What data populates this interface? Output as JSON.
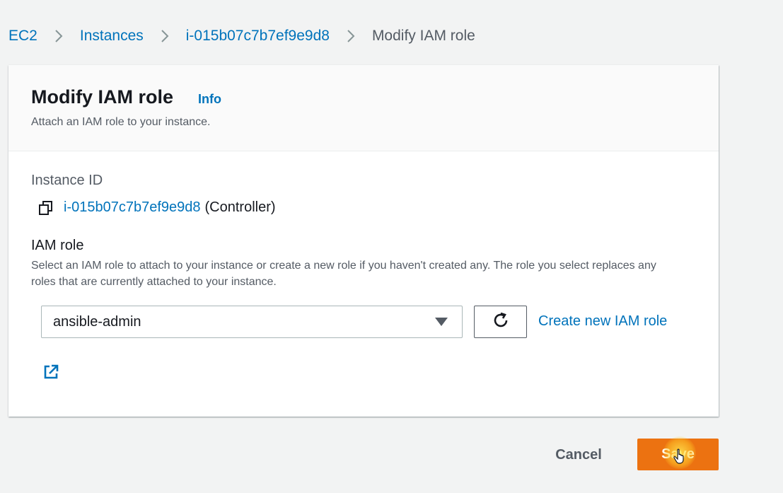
{
  "breadcrumb": {
    "items": [
      "EC2",
      "Instances",
      "i-015b07c7b7ef9e9d8"
    ],
    "current": "Modify IAM role"
  },
  "panel": {
    "title": "Modify IAM role",
    "info_label": "Info",
    "description": "Attach an IAM role to your instance."
  },
  "instance": {
    "label": "Instance ID",
    "id": "i-015b07c7b7ef9e9d8",
    "suffix": "(Controller)"
  },
  "iam_role": {
    "label": "IAM role",
    "description": "Select an IAM role to attach to your instance or create a new role if you haven't created any. The role you select replaces any roles that are currently attached to your instance.",
    "selected_value": "ansible-admin",
    "create_label": "Create new IAM role"
  },
  "footer": {
    "cancel_label": "Cancel",
    "save_label": "Save"
  },
  "colors": {
    "link": "#0073bb",
    "primary_button": "#ec7211",
    "background": "#f2f3f3"
  },
  "icons": {
    "breadcrumb_separator": "chevron-right-icon",
    "copy": "copy-icon",
    "refresh": "refresh-icon",
    "dropdown": "caret-down-icon",
    "external": "external-link-icon",
    "pointer": "hand-pointer-icon"
  }
}
